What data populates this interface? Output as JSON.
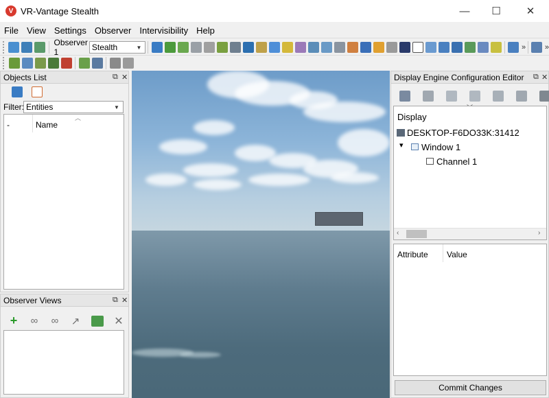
{
  "window": {
    "title": "VR-Vantage Stealth",
    "minimize_glyph": "—",
    "maximize_glyph": "☐",
    "close_glyph": "✕"
  },
  "menu": [
    "File",
    "View",
    "Settings",
    "Observer",
    "Intervisibility",
    "Help"
  ],
  "toolbar": {
    "observer_label": "Observer 1",
    "observer_mode": "Stealth",
    "overflow": "»"
  },
  "objects_list": {
    "title": "Objects List",
    "filter_label": "Filter:",
    "filter_value": "Entities",
    "col_dash": "-",
    "col_name": "Name"
  },
  "observer_views": {
    "title": "Observer Views"
  },
  "display_editor": {
    "title": "Display Engine Configuration Editor",
    "tree_header": "Display",
    "host": "DESKTOP-F6DO33K:31412",
    "window": "Window 1",
    "channel": "Channel 1",
    "col_attribute": "Attribute",
    "col_value": "Value",
    "commit_label": "Commit Changes"
  },
  "colors": {
    "app_icon": "#d83a2e",
    "add_green": "#2a9a2a",
    "delete_gray": "#707070"
  }
}
